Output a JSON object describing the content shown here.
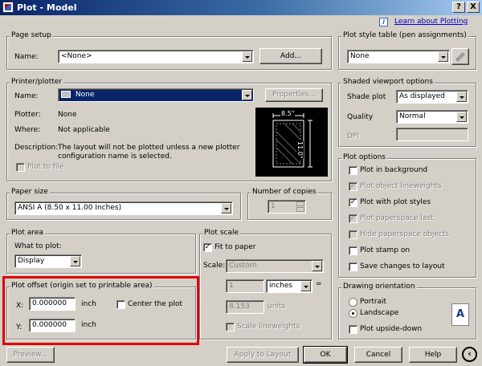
{
  "window": {
    "title": "Plot - Model",
    "help_btn": "?",
    "close_btn": "X"
  },
  "help_link": {
    "icon": "info-icon",
    "text": "Learn about Plotting"
  },
  "page_setup": {
    "legend": "Page setup",
    "name_label": "Name:",
    "name_value": "<None>",
    "add_button": "Add..."
  },
  "printer": {
    "legend": "Printer/plotter",
    "name_label": "Name:",
    "name_value": "None",
    "properties_button": "Properties...",
    "plotter_label": "Plotter:",
    "plotter_value": "None",
    "where_label": "Where:",
    "where_value": "Not applicable",
    "description_label": "Description:",
    "description_value": "The layout will not be plotted unless a new plotter configuration name is selected.",
    "plot_to_file": "Plot to file",
    "preview_width": "8.5\"",
    "preview_height": "11.0\""
  },
  "paper_size": {
    "legend": "Paper size",
    "value": "ANSI A (8.50 x 11.00 Inches)"
  },
  "copies": {
    "legend": "Number of copies",
    "value": "1"
  },
  "plot_area": {
    "legend": "Plot area",
    "what_label": "What to plot:",
    "what_value": "Display"
  },
  "plot_offset": {
    "legend": "Plot offset (origin set to printable area)",
    "x_label": "X:",
    "x_value": "0.000000",
    "x_unit": "inch",
    "y_label": "Y:",
    "y_value": "0.000000",
    "y_unit": "inch",
    "center_label": "Center the plot"
  },
  "plot_scale": {
    "legend": "Plot scale",
    "fit_label": "Fit to paper",
    "scale_label": "Scale:",
    "scale_value": "Custom",
    "value1": "1",
    "unit1": "inches",
    "equals": "=",
    "value2": "8.153",
    "unit2": "units",
    "lineweights_label": "Scale lineweights"
  },
  "style_table": {
    "legend": "Plot style table (pen assignments)",
    "value": "None"
  },
  "shaded": {
    "legend": "Shaded viewport options",
    "shade_label": "Shade plot",
    "shade_value": "As displayed",
    "quality_label": "Quality",
    "quality_value": "Normal",
    "dpi_label": "DPI"
  },
  "plot_options": {
    "legend": "Plot options",
    "items": [
      {
        "label": "Plot in background",
        "checked": false,
        "disabled": false
      },
      {
        "label": "Plot object lineweights",
        "checked": true,
        "disabled": true
      },
      {
        "label": "Plot with plot styles",
        "checked": true,
        "disabled": false
      },
      {
        "label": "Plot paperspace last",
        "checked": true,
        "disabled": true
      },
      {
        "label": "Hide paperspace objects",
        "checked": false,
        "disabled": true
      },
      {
        "label": "Plot stamp on",
        "checked": false,
        "disabled": false
      },
      {
        "label": "Save changes to layout",
        "checked": false,
        "disabled": false
      }
    ]
  },
  "orientation": {
    "legend": "Drawing orientation",
    "portrait": "Portrait",
    "landscape": "Landscape",
    "upside_down": "Plot upside-down",
    "icon_letter": "A"
  },
  "buttons": {
    "preview": "Preview...",
    "apply": "Apply to Layout",
    "ok": "OK",
    "cancel": "Cancel",
    "help": "Help"
  }
}
